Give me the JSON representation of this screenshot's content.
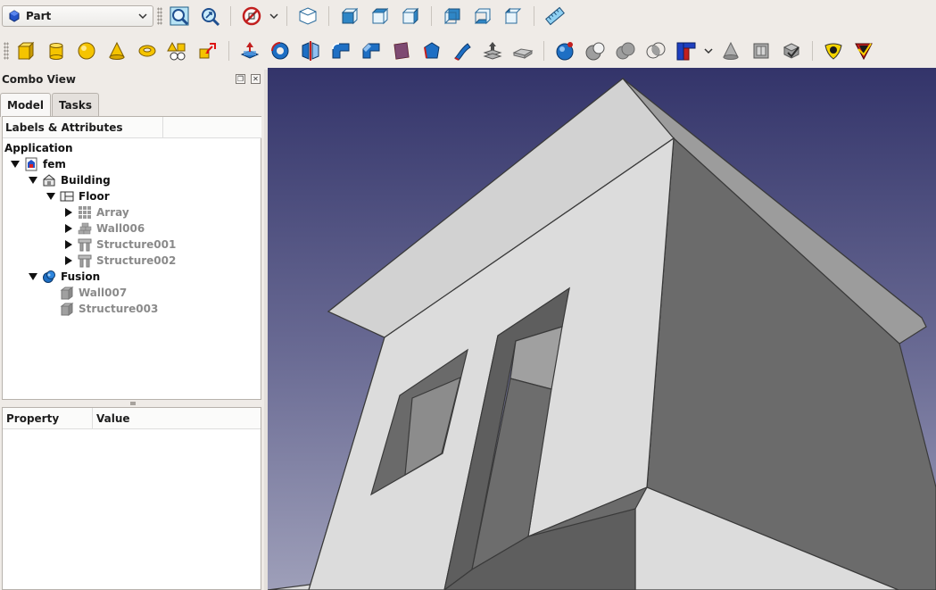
{
  "workbench": {
    "label": "Part",
    "icon": "part-workbench-icon"
  },
  "toolbar1": {
    "items": [
      "fit-all-icon",
      "fit-selection-icon",
      "draw-style-icon",
      "draw-style-dropdown-icon",
      "isometric-view-icon",
      "front-view-icon",
      "top-view-icon",
      "right-view-icon",
      "rear-view-icon",
      "bottom-view-icon",
      "left-view-icon",
      "measure-icon"
    ]
  },
  "toolbar2": {
    "items": [
      "cube-icon",
      "cylinder-icon",
      "sphere-icon",
      "cone-icon",
      "torus-icon",
      "primitives-icon",
      "shape-builder-icon",
      "extrude-icon",
      "revolve-icon",
      "mirror-icon",
      "fillet-icon",
      "chamfer-icon",
      "make-face-icon",
      "ruled-surface-icon",
      "loft-icon",
      "sweep-icon",
      "section-icon",
      "cross-sections-icon",
      "offset-icon",
      "thickness-icon",
      "projection-icon",
      "boolean-icon",
      "cut-icon",
      "fuse-icon",
      "common-icon",
      "join-features-icon",
      "join-dropdown-icon",
      "split-icon",
      "compound-icon",
      "check-geometry-icon",
      "defeaturing-icon"
    ]
  },
  "combo": {
    "title": "Combo View",
    "tabs": [
      {
        "label": "Model",
        "active": true
      },
      {
        "label": "Tasks",
        "active": false
      }
    ],
    "tree_header": "Labels & Attributes",
    "section_label": "Application",
    "tree": [
      {
        "label": "fem",
        "icon": "document-icon",
        "state": "expanded",
        "level": 0,
        "style": "bold"
      },
      {
        "label": "Building",
        "icon": "building-icon",
        "state": "expanded",
        "level": 1,
        "style": "bold"
      },
      {
        "label": "Floor",
        "icon": "floor-icon",
        "state": "expanded",
        "level": 2,
        "style": "bold"
      },
      {
        "label": "Array",
        "icon": "array-icon",
        "state": "collapsed",
        "level": 3,
        "style": "dim"
      },
      {
        "label": "Wall006",
        "icon": "wall-icon",
        "state": "collapsed",
        "level": 3,
        "style": "dim"
      },
      {
        "label": "Structure001",
        "icon": "structure-icon",
        "state": "collapsed",
        "level": 3,
        "style": "dim"
      },
      {
        "label": "Structure002",
        "icon": "structure-icon",
        "state": "collapsed",
        "level": 3,
        "style": "dim"
      },
      {
        "label": "Fusion",
        "icon": "fusion-icon",
        "state": "expanded",
        "level": 1,
        "style": "bold"
      },
      {
        "label": "Wall007",
        "icon": "solid-icon",
        "state": "leaf",
        "level": 2,
        "style": "dim"
      },
      {
        "label": "Structure003",
        "icon": "solid-icon",
        "state": "leaf",
        "level": 2,
        "style": "dim"
      }
    ],
    "property_headers": [
      "Property",
      "Value"
    ]
  },
  "colors": {
    "window_bg": "#efebe7",
    "view_top": "#33346a",
    "view_bottom": "#9e9fb9",
    "model_face_light": "#dcdcdc",
    "model_face_dark": "#6b6b6b",
    "accent_blue": "#1e6fc4"
  }
}
